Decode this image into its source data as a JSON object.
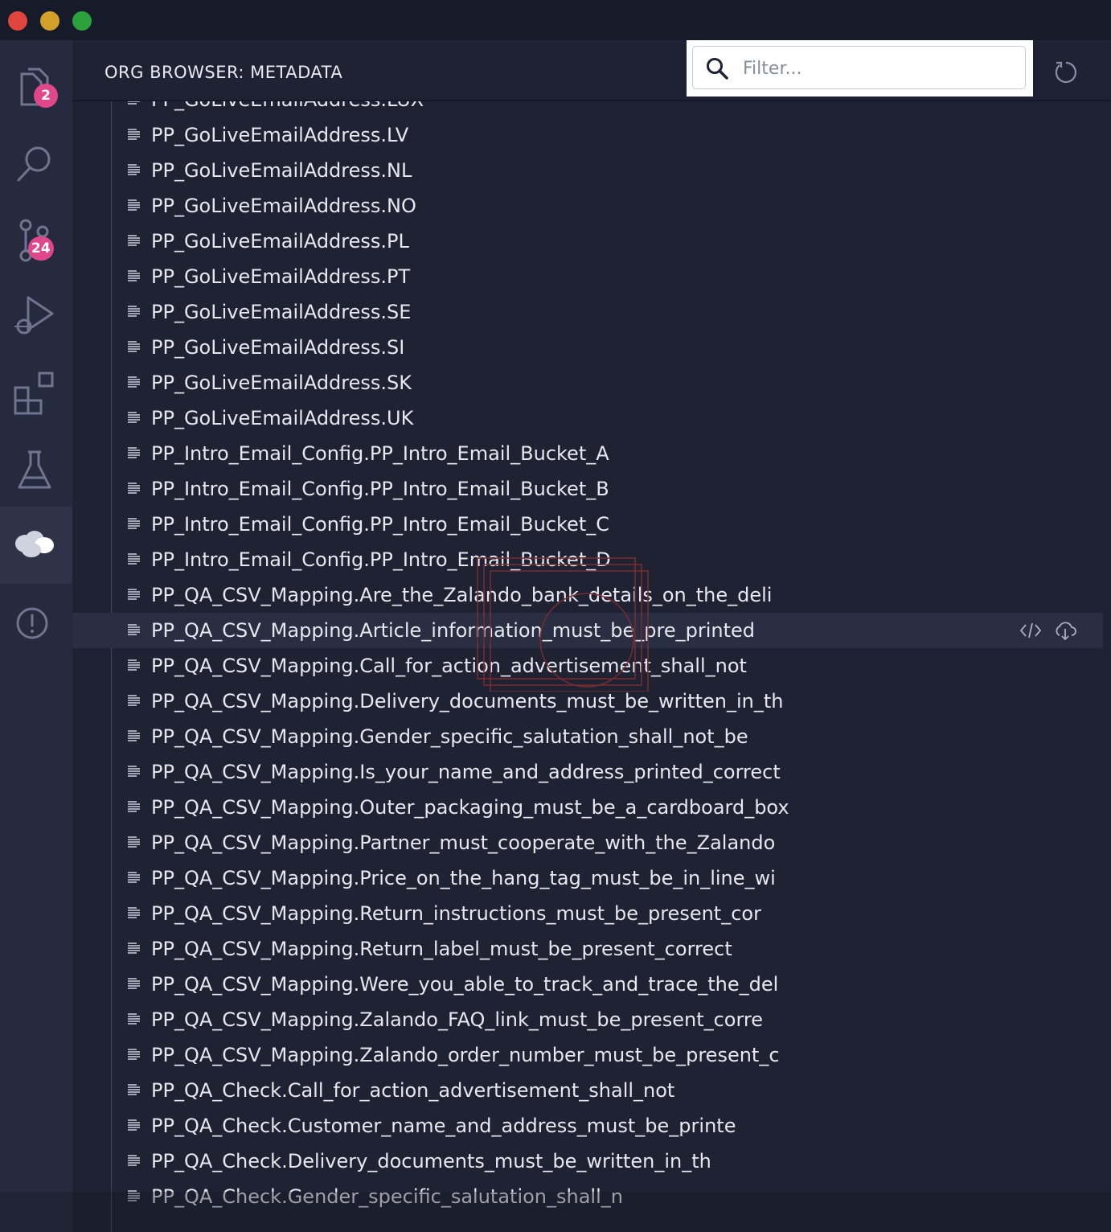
{
  "panel": {
    "title": "ORG BROWSER: METADATA",
    "filter_placeholder": "Filter..."
  },
  "activity": {
    "explorer_badge": "2",
    "source_control_badge": "24"
  },
  "icons": {
    "explorer": "files-icon",
    "search": "search-icon",
    "source_control": "source-control-icon",
    "run_debug": "run-debug-icon",
    "extensions": "extensions-icon",
    "testing": "flask-icon",
    "org_browser": "salesforce-cloud-icon",
    "problems": "warning-circle-icon",
    "refresh": "refresh-icon",
    "leaf": "list-lines-icon",
    "open_code": "code-icon",
    "retrieve": "cloud-download-icon"
  },
  "colors": {
    "badge": "#e0468a",
    "background": "#1f2233",
    "hover_row": "#2a2e43"
  },
  "items": [
    "PP_GoLiveEmailAddress.LUX",
    "PP_GoLiveEmailAddress.LV",
    "PP_GoLiveEmailAddress.NL",
    "PP_GoLiveEmailAddress.NO",
    "PP_GoLiveEmailAddress.PL",
    "PP_GoLiveEmailAddress.PT",
    "PP_GoLiveEmailAddress.SE",
    "PP_GoLiveEmailAddress.SI",
    "PP_GoLiveEmailAddress.SK",
    "PP_GoLiveEmailAddress.UK",
    "PP_Intro_Email_Config.PP_Intro_Email_Bucket_A",
    "PP_Intro_Email_Config.PP_Intro_Email_Bucket_B",
    "PP_Intro_Email_Config.PP_Intro_Email_Bucket_C",
    "PP_Intro_Email_Config.PP_Intro_Email_Bucket_D",
    "PP_QA_CSV_Mapping.Are_the_Zalando_bank_details_on_the_deli",
    "PP_QA_CSV_Mapping.Article_information_must_be_pre_printed",
    "PP_QA_CSV_Mapping.Call_for_action_advertisement_shall_not",
    "PP_QA_CSV_Mapping.Delivery_documents_must_be_written_in_th",
    "PP_QA_CSV_Mapping.Gender_specific_salutation_shall_not_be",
    "PP_QA_CSV_Mapping.Is_your_name_and_address_printed_correct",
    "PP_QA_CSV_Mapping.Outer_packaging_must_be_a_cardboard_box",
    "PP_QA_CSV_Mapping.Partner_must_cooperate_with_the_Zalando",
    "PP_QA_CSV_Mapping.Price_on_the_hang_tag_must_be_in_line_wi",
    "PP_QA_CSV_Mapping.Return_instructions_must_be_present_cor",
    "PP_QA_CSV_Mapping.Return_label_must_be_present_correct",
    "PP_QA_CSV_Mapping.Were_you_able_to_track_and_trace_the_del",
    "PP_QA_CSV_Mapping.Zalando_FAQ_link_must_be_present_corre",
    "PP_QA_CSV_Mapping.Zalando_order_number_must_be_present_c",
    "PP_QA_Check.Call_for_action_advertisement_shall_not",
    "PP_QA_Check.Customer_name_and_address_must_be_printe",
    "PP_QA_Check.Delivery_documents_must_be_written_in_th",
    "PP_QA_Check.Gender_specific_salutation_shall_n"
  ],
  "hovered_index": 15
}
